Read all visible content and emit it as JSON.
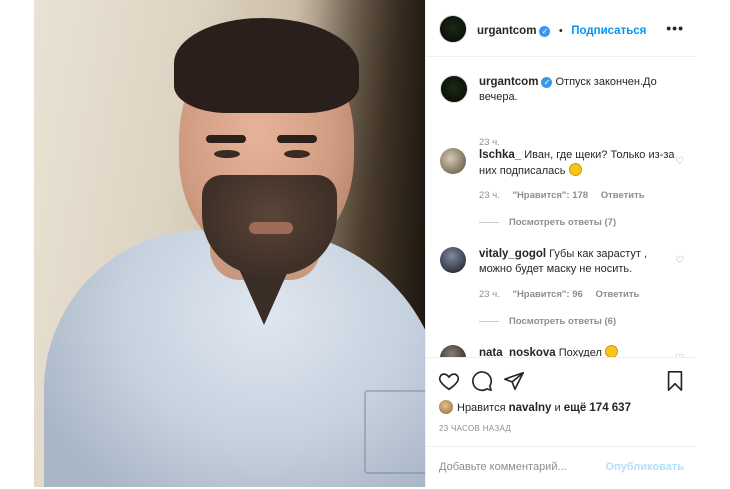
{
  "post": {
    "author": "urgantcom",
    "follow_label": "Подписаться",
    "more_icon": "more-dots-icon"
  },
  "caption": {
    "author": "urgantcom",
    "text": "Отпуск закончен.До вечера.",
    "time": "23 ч."
  },
  "comments": [
    {
      "author": "lschka_",
      "text": "Иван, где щеки? Только из-за них подписалась",
      "emoji": "grinning-sweat-emoji",
      "time": "23 ч.",
      "likes": "\"Нравится\": 178",
      "reply": "Ответить",
      "view_replies": "Посмотреть ответы (7)"
    },
    {
      "author": "vitaly_gogol",
      "text": "Губы как зарастут , можно будет маску не носить.",
      "time": "23 ч.",
      "likes": "\"Нравится\": 96",
      "reply": "Ответить",
      "view_replies": "Посмотреть ответы (6)"
    },
    {
      "author": "nata_noskova",
      "text": "Похудел",
      "emoji": "smiling-emoji"
    }
  ],
  "actions": {
    "like_icon": "heart-icon",
    "comment_icon": "comment-icon",
    "share_icon": "share-icon",
    "save_icon": "bookmark-icon"
  },
  "likes": {
    "prefix": "Нравится",
    "user": "navalny",
    "middle": "и",
    "rest": "ещё 174 637"
  },
  "time_ago": "23 ЧАСОВ НАЗАД",
  "add_comment": {
    "placeholder": "Добавьте комментарий...",
    "publish_label": "Опубликовать"
  },
  "colors": {
    "link_blue": "#0095f6",
    "verified_blue": "#3897f0",
    "muted_text": "#8e8e8e",
    "publish_disabled": "#b2dffc"
  }
}
